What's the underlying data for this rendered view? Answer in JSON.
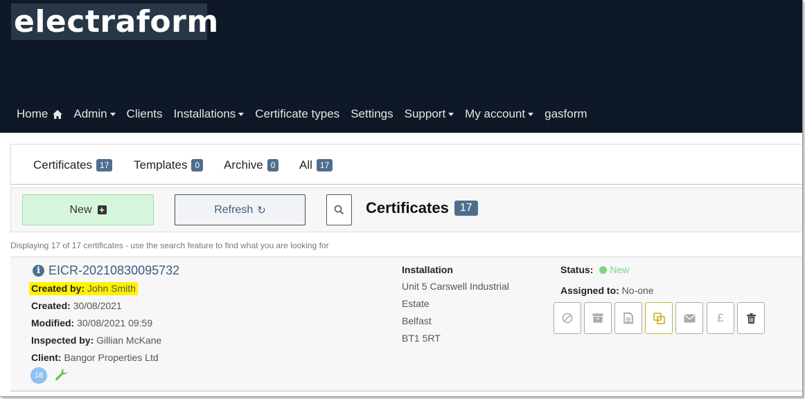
{
  "brand": {
    "logo_text": "electraform"
  },
  "nav": {
    "items": [
      {
        "label": "Home",
        "icon": "home-icon"
      },
      {
        "label": "Admin",
        "dropdown": true
      },
      {
        "label": "Clients"
      },
      {
        "label": "Installations",
        "dropdown": true
      },
      {
        "label": "Certificate types"
      },
      {
        "label": "Settings"
      },
      {
        "label": "Support",
        "dropdown": true
      },
      {
        "label": "My account",
        "dropdown": true
      },
      {
        "label": "gasform"
      }
    ]
  },
  "tabs": [
    {
      "label": "Certificates",
      "count": "17"
    },
    {
      "label": "Templates",
      "count": "0"
    },
    {
      "label": "Archive",
      "count": "0"
    },
    {
      "label": "All",
      "count": "17"
    }
  ],
  "toolbar": {
    "new_label": "New",
    "refresh_label": "Refresh",
    "heading": "Certificates",
    "heading_count": "17"
  },
  "display_info": "Displaying 17 of 17 certificates - use the search feature to find what you are looking for",
  "record": {
    "id": "EICR-20210830095732",
    "created_by_label": "Created by:",
    "created_by": "John Smith",
    "created_label": "Created:",
    "created": "30/08/2021",
    "modified_label": "Modified:",
    "modified": "30/08/2021 09:59",
    "inspected_by_label": "Inspected by:",
    "inspected_by": "Gillian McKane",
    "client_label": "Client:",
    "client": "Bangor Properties Ltd",
    "count": "18",
    "installation_label": "Installation",
    "installation_lines": [
      "Unit 5 Carswell Industrial",
      "Estate",
      "Belfast",
      "BT1 5RT"
    ],
    "status_label": "Status:",
    "status": "New",
    "assigned_label": "Assigned to:",
    "assigned_to": "No-one"
  },
  "colors": {
    "header_bg": "#0e1826",
    "badge": "#4f6e8e",
    "new_button_bg": "#d6f6db",
    "status_new": "#7fd67f",
    "highlight": "#fff200"
  }
}
